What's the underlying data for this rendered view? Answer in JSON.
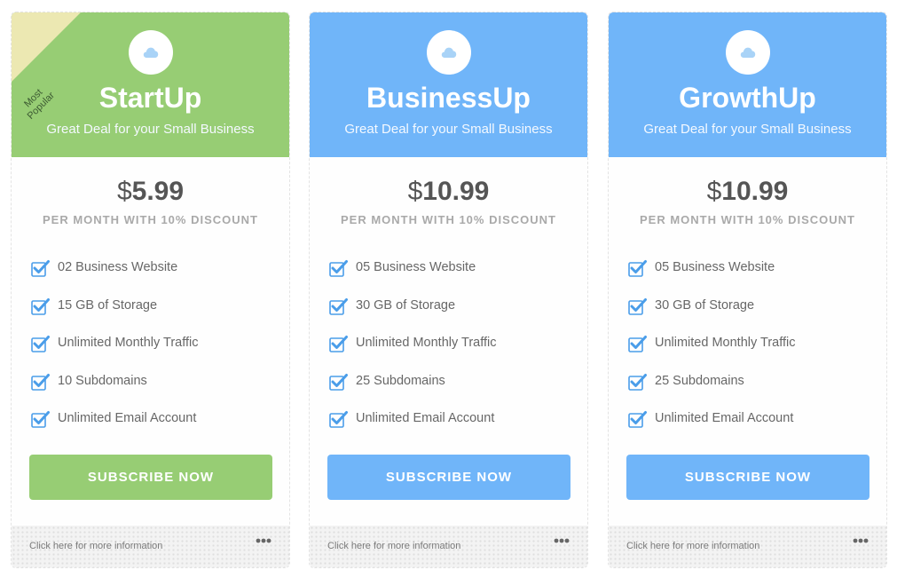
{
  "colors": {
    "green": "#97cd74",
    "blue": "#70b5f9",
    "ribbon": "#ece8b2",
    "check": "#4a9de9"
  },
  "plans": [
    {
      "name": "StartUp",
      "tagline": "Great Deal for your Small Business",
      "icon": "cloud-icon",
      "ribbon": "Most Popular",
      "currency": "$",
      "price": "5.99",
      "price_note": "PER MONTH WITH 10% DISCOUNT",
      "features": [
        "02 Business Website",
        "15 GB of Storage",
        "Unlimited Monthly Traffic",
        "10 Subdomains",
        "Unlimited Email Account"
      ],
      "button": "SUBSCRIBE NOW",
      "more_info": "Click here for more information"
    },
    {
      "name": "BusinessUp",
      "tagline": "Great Deal for your Small Business",
      "icon": "cloud-icon",
      "currency": "$",
      "price": "10.99",
      "price_note": "PER MONTH WITH 10% DISCOUNT",
      "features": [
        "05 Business Website",
        "30 GB of Storage",
        "Unlimited Monthly Traffic",
        "25 Subdomains",
        "Unlimited Email Account"
      ],
      "button": "SUBSCRIBE NOW",
      "more_info": "Click here for more information"
    },
    {
      "name": "GrowthUp",
      "tagline": "Great Deal for your Small Business",
      "icon": "cloud-icon",
      "currency": "$",
      "price": "10.99",
      "price_note": "PER MONTH WITH 10% DISCOUNT",
      "features": [
        "05 Business Website",
        "30 GB of Storage",
        "Unlimited Monthly Traffic",
        "25 Subdomains",
        "Unlimited Email Account"
      ],
      "button": "SUBSCRIBE NOW",
      "more_info": "Click here for more information"
    }
  ]
}
